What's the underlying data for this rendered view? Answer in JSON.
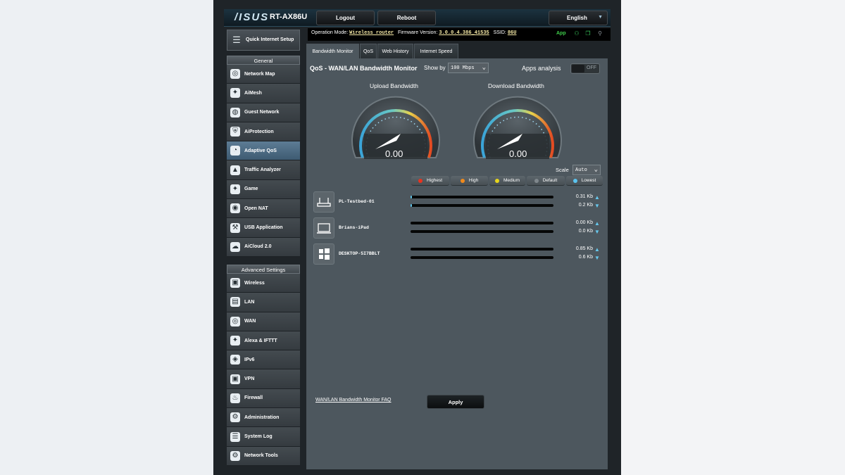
{
  "header": {
    "brand": "/ISUS",
    "model": "RT-AX86U",
    "logout_label": "Logout",
    "reboot_label": "Reboot",
    "language": "English"
  },
  "info": {
    "op_mode_label": "Operation Mode:",
    "op_mode_value": "Wireless router",
    "firmware_label": "Firmware Version:",
    "firmware_value": "3.0.0.4.386_41535",
    "ssid_label": "SSID:",
    "ssid_value": "86U",
    "app_label": "App"
  },
  "sidebar": {
    "quick_setup": "Quick Internet Setup",
    "general_header": "General",
    "general_items": [
      {
        "label": "Network Map",
        "icon": "network-map-icon",
        "glyph": "◎",
        "active": false
      },
      {
        "label": "AiMesh",
        "icon": "aimesh-icon",
        "glyph": "✦",
        "active": false
      },
      {
        "label": "Guest Network",
        "icon": "guest-network-icon",
        "glyph": "◍",
        "active": false
      },
      {
        "label": "AiProtection",
        "icon": "shield-icon",
        "glyph": "⛨",
        "active": false
      },
      {
        "label": "Adaptive QoS",
        "icon": "qos-gauge-icon",
        "glyph": "◔",
        "active": true
      },
      {
        "label": "Traffic Analyzer",
        "icon": "traffic-analyzer-icon",
        "glyph": "▲",
        "active": false
      },
      {
        "label": "Game",
        "icon": "gamepad-icon",
        "glyph": "✦",
        "active": false
      },
      {
        "label": "Open NAT",
        "icon": "open-nat-icon",
        "glyph": "◉",
        "active": false
      },
      {
        "label": "USB Application",
        "icon": "usb-icon",
        "glyph": "⚒",
        "active": false
      },
      {
        "label": "AiCloud 2.0",
        "icon": "cloud-icon",
        "glyph": "☁",
        "active": false
      }
    ],
    "advanced_header": "Advanced Settings",
    "advanced_items": [
      {
        "label": "Wireless",
        "icon": "wireless-icon",
        "glyph": "▣",
        "active": false
      },
      {
        "label": "LAN",
        "icon": "lan-icon",
        "glyph": "▤",
        "active": false
      },
      {
        "label": "WAN",
        "icon": "wan-globe-icon",
        "glyph": "◎",
        "active": false
      },
      {
        "label": "Alexa & IFTTT",
        "icon": "alexa-icon",
        "glyph": "✦",
        "active": false
      },
      {
        "label": "IPv6",
        "icon": "ipv6-icon",
        "glyph": "◈",
        "active": false
      },
      {
        "label": "VPN",
        "icon": "vpn-icon",
        "glyph": "▣",
        "active": false
      },
      {
        "label": "Firewall",
        "icon": "firewall-icon",
        "glyph": "♨",
        "active": false
      },
      {
        "label": "Administration",
        "icon": "administration-icon",
        "glyph": "⚙",
        "active": false
      },
      {
        "label": "System Log",
        "icon": "system-log-icon",
        "glyph": "☰",
        "active": false
      },
      {
        "label": "Network Tools",
        "icon": "network-tools-icon",
        "glyph": "⚙",
        "active": false
      }
    ]
  },
  "tabs": [
    "Bandwidth Monitor",
    "QoS",
    "Web History",
    "Internet Speed"
  ],
  "panel": {
    "title": "QoS - WAN/LAN Bandwidth Monitor",
    "show_by_label": "Show by",
    "show_by_value": "100 Mbps",
    "apps_analysis_label": "Apps analysis",
    "apps_analysis_state": "OFF",
    "upload_title": "Upload Bandwidth",
    "download_title": "Download Bandwidth",
    "upload_value": "0.00",
    "download_value": "0.00",
    "scale_label": "Scale",
    "scale_value": "Auto",
    "legend": [
      {
        "label": "Highest",
        "color": "#e8331f"
      },
      {
        "label": "High",
        "color": "#f08a1c"
      },
      {
        "label": "Medium",
        "color": "#e6d51c"
      },
      {
        "label": "Default",
        "color": "#7f878c"
      },
      {
        "label": "Lowest",
        "color": "#5bc3ee"
      }
    ],
    "devices": [
      {
        "name": "PL-Testbed-01",
        "icon": "router-icon",
        "up_rate": "0.31 Kb",
        "down_rate": "0.2 Kb",
        "up_fill": 0.01,
        "down_fill": 0.01
      },
      {
        "name": "Brians-iPad",
        "icon": "laptop-icon",
        "up_rate": "0.00 Kb",
        "down_rate": "0.0 Kb",
        "up_fill": 0,
        "down_fill": 0
      },
      {
        "name": "DESKTOP-5I7BBLT",
        "icon": "windows-icon",
        "up_rate": "0.85 Kb",
        "down_rate": "0.6 Kb",
        "up_fill": 0,
        "down_fill": 0
      }
    ],
    "faq_link": "WAN/LAN Bandwidth Monitor FAQ",
    "apply_label": "Apply"
  }
}
